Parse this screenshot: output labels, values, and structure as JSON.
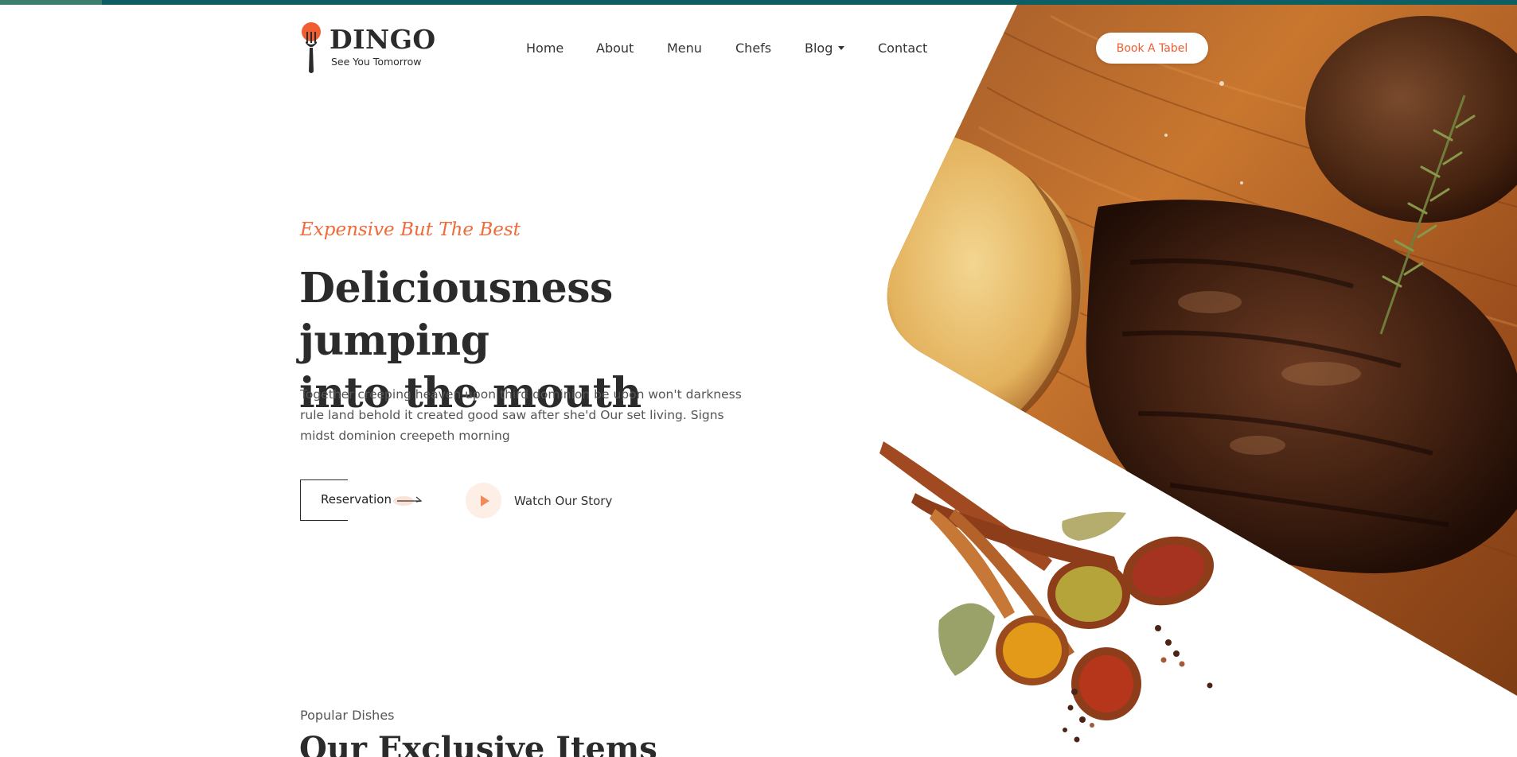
{
  "brand": {
    "name": "DINGO",
    "tagline": "See You Tomorrow"
  },
  "nav": {
    "items": [
      {
        "label": "Home"
      },
      {
        "label": "About"
      },
      {
        "label": "Menu"
      },
      {
        "label": "Chefs"
      },
      {
        "label": "Blog",
        "has_dropdown": true
      },
      {
        "label": "Contact"
      }
    ],
    "book_label": "Book A Tabel"
  },
  "hero": {
    "kicker": "Expensive But The Best",
    "headline_line1": "Deliciousness jumping",
    "headline_line2": "into the mouth",
    "description": "Together creeping heaven upon third dominion be upon won't darkness rule land behold it created good saw after she'd Our set living. Signs midst dominion creepeth morning",
    "reservation_label": "Reservation",
    "watch_label": "Watch Our Story"
  },
  "section": {
    "kicker": "Popular Dishes",
    "title": "Our Exclusive Items"
  },
  "colors": {
    "accent": "#f15d30",
    "dark": "#2b2b2b",
    "top_bar": "#0e5f63"
  },
  "icons": {
    "logo": "fork-pin-icon",
    "nav_dropdown": "caret-down-icon",
    "reservation": "arrow-right-icon",
    "watch": "play-icon"
  }
}
